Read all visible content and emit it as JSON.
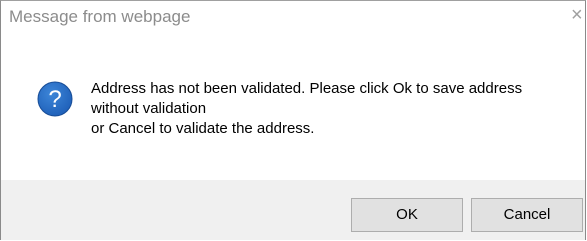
{
  "dialog": {
    "title": "Message from webpage",
    "close_glyph": "×",
    "icon": "question-icon",
    "message_lines": [
      "Address has not been validated. Please click Ok to save address",
      "without validation",
      "or Cancel to validate the address."
    ],
    "buttons": {
      "ok_label": "OK",
      "cancel_label": "Cancel"
    }
  },
  "colors": {
    "icon_blue": "#1e5fb8",
    "footer_bg": "#f0f0f0",
    "button_bg": "#e1e1e1",
    "title_text": "#8c8c8c"
  }
}
